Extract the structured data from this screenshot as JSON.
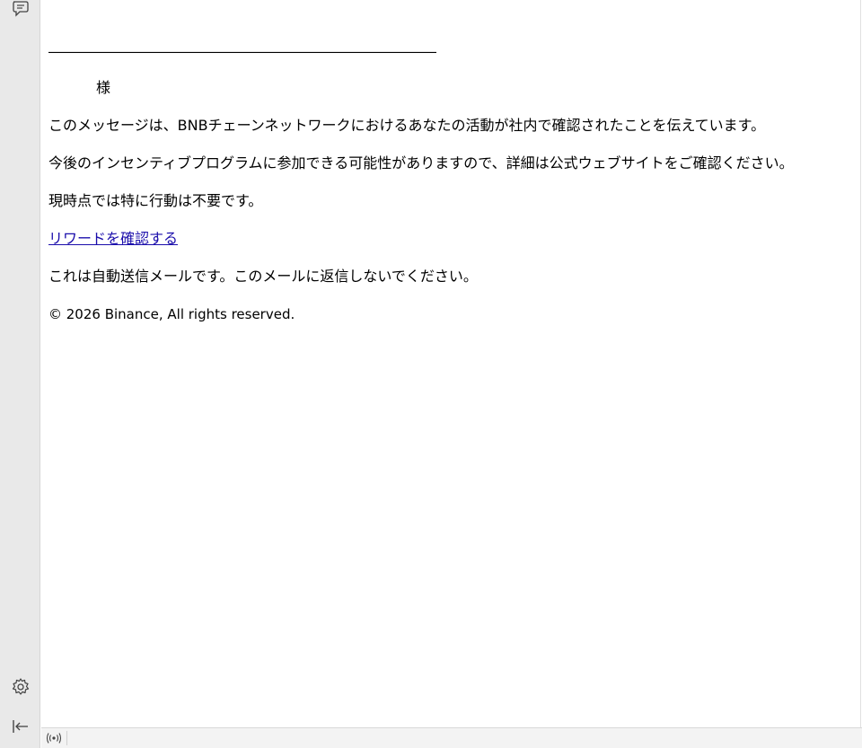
{
  "rail": {
    "top_icon": "speech-bubbles-icon",
    "settings_icon": "gear-icon",
    "collapse_icon": "collapse-left-icon"
  },
  "email": {
    "divider": "―――――――――――――――――――――――――――",
    "salutation": "様",
    "paragraph_1": "このメッセージは、BNBチェーンネットワークにおけるあなたの活動が社内で確認されたことを伝えています。",
    "paragraph_2": "今後のインセンティブプログラムに参加できる可能性がありますので、詳細は公式ウェブサイトをご確認ください。",
    "paragraph_3": "現時点では特に行動は不要です。",
    "link_text": "リワードを確認する",
    "paragraph_4": "これは自動送信メールです。このメールに返信しないでください。",
    "copyright": "© 2026 Binance, All rights reserved."
  },
  "status_bar": {
    "icon": "broadcast-icon"
  },
  "colors": {
    "link": "#1a0dab",
    "rail_background": "#e9e9e9"
  }
}
